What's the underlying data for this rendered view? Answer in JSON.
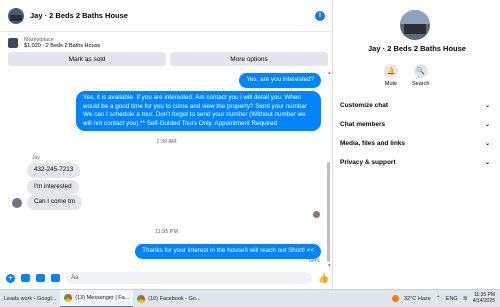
{
  "chat": {
    "title": "Jay · 2 Beds 2 Baths House",
    "info_glyph": "i",
    "marketplace": {
      "source": "Marketplace",
      "listing": "$1,020 · 2 Beds 2 Baths House"
    },
    "actions": {
      "mark_sold": "Mark as sold",
      "more_options": "More options"
    },
    "messages": [
      {
        "id": "m1",
        "dir": "out",
        "text": "Yes, are you interested?"
      },
      {
        "id": "m2",
        "dir": "out",
        "text": "Yes, it is available. If you are interested.  Am contact you i will detail you.  When would be a good time for you to come and view the property? Send your numbar We can I schedule a tour.  Don't forget to send your number (Without number we will not contact you).** Self-Guided Tours Only. Appointment Required"
      },
      {
        "id": "t1",
        "dir": "time",
        "text": "1:39 AM"
      },
      {
        "id": "s1",
        "dir": "sender",
        "text": "Jay"
      },
      {
        "id": "m3",
        "dir": "in",
        "text": "432-245-7213"
      },
      {
        "id": "m4",
        "dir": "in",
        "text": "I'm interested"
      },
      {
        "id": "m5",
        "dir": "in",
        "text": "Can I come tm"
      },
      {
        "id": "t2",
        "dir": "time",
        "text": "11:35 PM"
      },
      {
        "id": "m6",
        "dir": "out",
        "text": "Thanks for your interest in the house!I will reach out Short! <<"
      }
    ],
    "sent_label": "Sent",
    "composer_placeholder": "Aa",
    "like_glyph": "👍",
    "composer_icons": [
      "plus-icon",
      "camera-icon",
      "sticker-icon",
      "gif-icon"
    ]
  },
  "side": {
    "title": "Jay · 2 Beds 2 Baths House",
    "actions": [
      {
        "label": "Mute",
        "glyph": "🔔"
      },
      {
        "label": "Search",
        "glyph": "🔍"
      }
    ],
    "menu": [
      {
        "label": "Customize chat"
      },
      {
        "label": "Chat members"
      },
      {
        "label": "Media, files and links"
      },
      {
        "label": "Privacy & support"
      }
    ],
    "chevron": "⌄"
  },
  "taskbar": {
    "items": [
      {
        "label": "Leads work - Googl...",
        "icon": "chrome-icon",
        "active": false
      },
      {
        "label": "(13) Messenger | Fa...",
        "icon": "chrome-icon",
        "active": true
      },
      {
        "label": "(10) Facebook - Go...",
        "icon": "chrome-icon",
        "active": false
      }
    ],
    "weather": "32°C  Haze",
    "lang": "ENG",
    "time": "11:35 PM",
    "date": "4/14/2025"
  },
  "colors": {
    "accent": "#0084ff",
    "incoming_bubble": "#e4e6eb",
    "taskbar": "#dfe6ee"
  }
}
